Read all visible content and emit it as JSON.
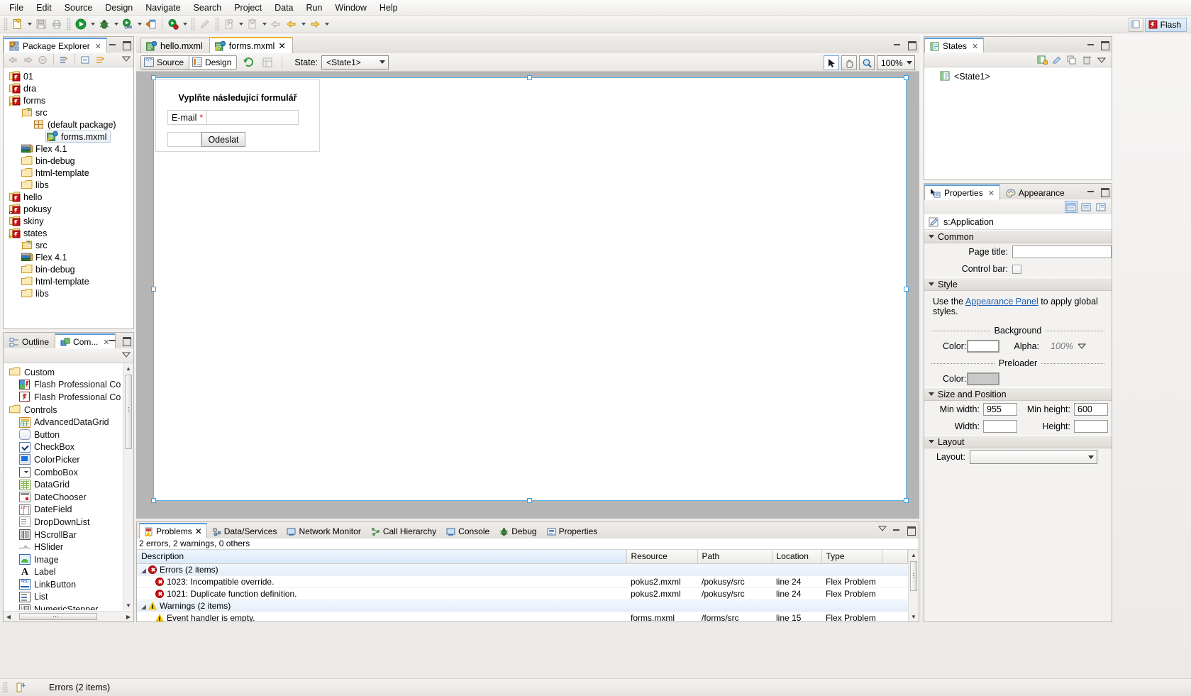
{
  "menubar": {
    "items": [
      "File",
      "Edit",
      "Source",
      "Design",
      "Navigate",
      "Search",
      "Project",
      "Data",
      "Run",
      "Window",
      "Help"
    ]
  },
  "toolbar": {
    "perspective_label": "Flash",
    "icons": [
      "new-file-icon",
      "save-icon",
      "print-icon",
      "run-icon",
      "debug-icon",
      "profile-icon",
      "export-release-icon",
      "debug-connect-icon",
      "edit-icon",
      "new-item-icon",
      "open-type-icon",
      "back-nav-icon",
      "prev-edit-icon",
      "next-edit-icon"
    ]
  },
  "package_explorer": {
    "tab_label": "Package Explorer",
    "toolbar_icons": [
      "back-icon",
      "forward-icon",
      "collapse-icon",
      "link-editor-icon",
      "collapse-all-icon",
      "view-menu-icon",
      "menu-icon"
    ],
    "tree": [
      {
        "label": "01",
        "icon": "flex-project-icon",
        "depth": 0
      },
      {
        "label": "dra",
        "icon": "flex-project-icon",
        "depth": 0
      },
      {
        "label": "forms",
        "icon": "flex-project-warning-icon",
        "depth": 0
      },
      {
        "label": "src",
        "icon": "source-folder-icon",
        "depth": 1
      },
      {
        "label": "(default package)",
        "icon": "package-icon",
        "depth": 2
      },
      {
        "label": "forms.mxml",
        "icon": "mxml-file-icon",
        "depth": 3,
        "selected": true
      },
      {
        "label": "Flex 4.1",
        "icon": "flex-sdk-icon",
        "depth": 1
      },
      {
        "label": "bin-debug",
        "icon": "folder-icon",
        "depth": 1
      },
      {
        "label": "html-template",
        "icon": "folder-icon",
        "depth": 1
      },
      {
        "label": "libs",
        "icon": "folder-icon",
        "depth": 1
      },
      {
        "label": "hello",
        "icon": "flex-project-icon",
        "depth": 0
      },
      {
        "label": "pokusy",
        "icon": "flex-project-error-icon",
        "depth": 0
      },
      {
        "label": "skiny",
        "icon": "flex-project-icon",
        "depth": 0
      },
      {
        "label": "states",
        "icon": "flex-project-warning-icon",
        "depth": 0
      },
      {
        "label": "src",
        "icon": "source-folder-icon",
        "depth": 1
      },
      {
        "label": "Flex 4.1",
        "icon": "flex-sdk-icon",
        "depth": 1
      },
      {
        "label": "bin-debug",
        "icon": "folder-icon",
        "depth": 1
      },
      {
        "label": "html-template",
        "icon": "folder-icon",
        "depth": 1
      },
      {
        "label": "libs",
        "icon": "folder-icon",
        "depth": 1
      }
    ]
  },
  "components_view": {
    "tabs": [
      {
        "label": "Outline",
        "icon": "outline-icon",
        "active": false
      },
      {
        "label": "Com...",
        "icon": "components-icon",
        "active": true
      }
    ],
    "items": [
      {
        "label": "Custom",
        "icon": "folder-icon",
        "group": true
      },
      {
        "label": "Flash Professional Co",
        "icon": "flash-component-icon",
        "group": false
      },
      {
        "label": "Flash Professional Co",
        "icon": "flash-container-icon",
        "group": false
      },
      {
        "label": "Controls",
        "icon": "folder-icon",
        "group": true
      },
      {
        "label": "AdvancedDataGrid",
        "icon": "advanced-datagrid-icon",
        "group": false
      },
      {
        "label": "Button",
        "icon": "button-icon",
        "group": false
      },
      {
        "label": "CheckBox",
        "icon": "checkbox-icon",
        "group": false
      },
      {
        "label": "ColorPicker",
        "icon": "colorpicker-icon",
        "group": false
      },
      {
        "label": "ComboBox",
        "icon": "combobox-icon",
        "group": false
      },
      {
        "label": "DataGrid",
        "icon": "datagrid-icon",
        "group": false
      },
      {
        "label": "DateChooser",
        "icon": "datechooser-icon",
        "group": false
      },
      {
        "label": "DateField",
        "icon": "datefield-icon",
        "group": false
      },
      {
        "label": "DropDownList",
        "icon": "dropdownlist-icon",
        "group": false
      },
      {
        "label": "HScrollBar",
        "icon": "hscrollbar-icon",
        "group": false
      },
      {
        "label": "HSlider",
        "icon": "hslider-icon",
        "group": false
      },
      {
        "label": "Image",
        "icon": "image-icon",
        "group": false
      },
      {
        "label": "Label",
        "icon": "label-icon",
        "group": false
      },
      {
        "label": "LinkButton",
        "icon": "linkbutton-icon",
        "group": false
      },
      {
        "label": "List",
        "icon": "list-icon",
        "group": false
      },
      {
        "label": "NumericStepper",
        "icon": "numericstepper-icon",
        "group": false
      }
    ]
  },
  "editor": {
    "tabs": [
      {
        "label": "hello.mxml",
        "active": false,
        "closable": false
      },
      {
        "label": "forms.mxml",
        "active": true,
        "closable": true
      }
    ],
    "mode_buttons": [
      {
        "label": "Source",
        "active": false
      },
      {
        "label": "Design",
        "active": true
      }
    ],
    "refresh_icon": "refresh-icon",
    "layout_icon": "layout-icon",
    "state_label": "State:",
    "state_value": "<State1>",
    "tool_select_icon": "select-tool-icon",
    "tool_pan_icon": "hand-tool-icon",
    "tool_zoom_icon": "zoom-tool-icon",
    "zoom_value": "100%"
  },
  "design_form": {
    "title": "Vyplňte následující formulář",
    "email_label": "E-mail",
    "required_mark": "*",
    "email_value": "",
    "submit_label": "Odeslat"
  },
  "problems": {
    "tabs": [
      {
        "label": "Problems",
        "icon": "problems-icon",
        "active": true
      },
      {
        "label": "Data/Services",
        "icon": "data-services-icon",
        "active": false
      },
      {
        "label": "Network Monitor",
        "icon": "network-monitor-icon",
        "active": false
      },
      {
        "label": "Call Hierarchy",
        "icon": "call-hierarchy-icon",
        "active": false
      },
      {
        "label": "Console",
        "icon": "console-icon",
        "active": false
      },
      {
        "label": "Debug",
        "icon": "debug-icon",
        "active": false
      },
      {
        "label": "Properties",
        "icon": "properties-icon",
        "active": false
      }
    ],
    "summary": "2 errors, 2 warnings, 0 others",
    "columns": [
      "Description",
      "Resource",
      "Path",
      "Location",
      "Type"
    ],
    "rows": [
      {
        "kind": "group",
        "severity": "error",
        "description": "Errors (2 items)",
        "resource": "",
        "path": "",
        "location": "",
        "type": ""
      },
      {
        "kind": "item",
        "severity": "error",
        "description": "1023: Incompatible override.",
        "resource": "pokus2.mxml",
        "path": "/pokusy/src",
        "location": "line 24",
        "type": "Flex Problem"
      },
      {
        "kind": "item",
        "severity": "error",
        "description": "1021: Duplicate function definition.",
        "resource": "pokus2.mxml",
        "path": "/pokusy/src",
        "location": "line 24",
        "type": "Flex Problem"
      },
      {
        "kind": "group",
        "severity": "warning",
        "description": "Warnings (2 items)",
        "resource": "",
        "path": "",
        "location": "",
        "type": ""
      },
      {
        "kind": "item",
        "severity": "warning",
        "description": "Event handler is empty.",
        "resource": "forms.mxml",
        "path": "/forms/src",
        "location": "line 15",
        "type": "Flex Problem"
      }
    ]
  },
  "states_view": {
    "tab_label": "States",
    "toolbar_icons": [
      "new-state-icon",
      "edit-state-icon",
      "duplicate-state-icon",
      "delete-state-icon",
      "view-menu-icon"
    ],
    "items": [
      {
        "label": "<State1>",
        "icon": "state-icon"
      }
    ]
  },
  "properties_view": {
    "tabs": [
      {
        "label": "Properties",
        "icon": "properties-pointer-icon",
        "active": true
      },
      {
        "label": "Appearance",
        "icon": "appearance-palette-icon",
        "active": false
      }
    ],
    "toolbar_icons": [
      "category-view-icon",
      "alpha-view-icon",
      "standard-view-icon"
    ],
    "selection": "s:Application",
    "sections": {
      "common": {
        "title": "Common",
        "page_title_label": "Page title:",
        "page_title_value": "",
        "control_bar_label": "Control bar:",
        "control_bar_checked": false
      },
      "style": {
        "title": "Style",
        "hint_prefix": "Use the ",
        "hint_link": "Appearance Panel",
        "hint_suffix": " to apply global styles.",
        "background_label": "Background",
        "bg_color_label": "Color:",
        "bg_color_value": "#FFFFFF",
        "alpha_label": "Alpha:",
        "alpha_value": "100%",
        "preloader_label": "Preloader",
        "preloader_color_label": "Color:",
        "preloader_color_value": "#C9C9C9"
      },
      "size_and_position": {
        "title": "Size and Position",
        "min_width_label": "Min width:",
        "min_width_value": "955",
        "min_height_label": "Min height:",
        "min_height_value": "600",
        "width_label": "Width:",
        "width_value": "",
        "height_label": "Height:",
        "height_value": ""
      },
      "layout": {
        "title": "Layout",
        "layout_label": "Layout:",
        "layout_value": ""
      }
    }
  },
  "statusbar": {
    "icon": "smart-insert-icon",
    "text": "Errors (2 items)"
  }
}
